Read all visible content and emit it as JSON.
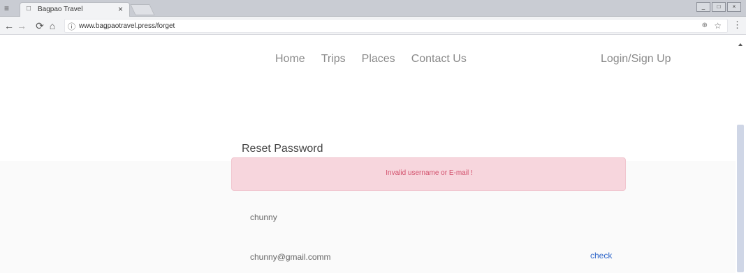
{
  "browser": {
    "tab_title": "Bagpao Travel",
    "address_url": "www.bagpaotravel.press/forget"
  },
  "site": {
    "nav": {
      "home": "Home",
      "trips": "Trips",
      "places": "Places",
      "contact": "Contact Us",
      "login": "Login/Sign Up"
    },
    "form": {
      "title": "Reset Password",
      "error": "Invalid username or E-mail !",
      "username": "chunny",
      "email": "chunny@gmail.comm",
      "check": "check"
    }
  },
  "icons": {
    "browser_menu": "menu-icon",
    "tab_page": "page-icon",
    "tab_close": "close-icon",
    "back": "back-arrow-icon",
    "forward": "forward-arrow-icon",
    "reload": "reload-icon",
    "home": "home-icon",
    "info": "info-icon",
    "zoom": "zoom-icon",
    "star": "star-icon",
    "more": "more-vertical-icon"
  },
  "colors": {
    "alert_bg": "#f7d6dd",
    "alert_text": "#d24f6b",
    "link": "#2f66c9",
    "nav_text": "#8a8a8a"
  }
}
